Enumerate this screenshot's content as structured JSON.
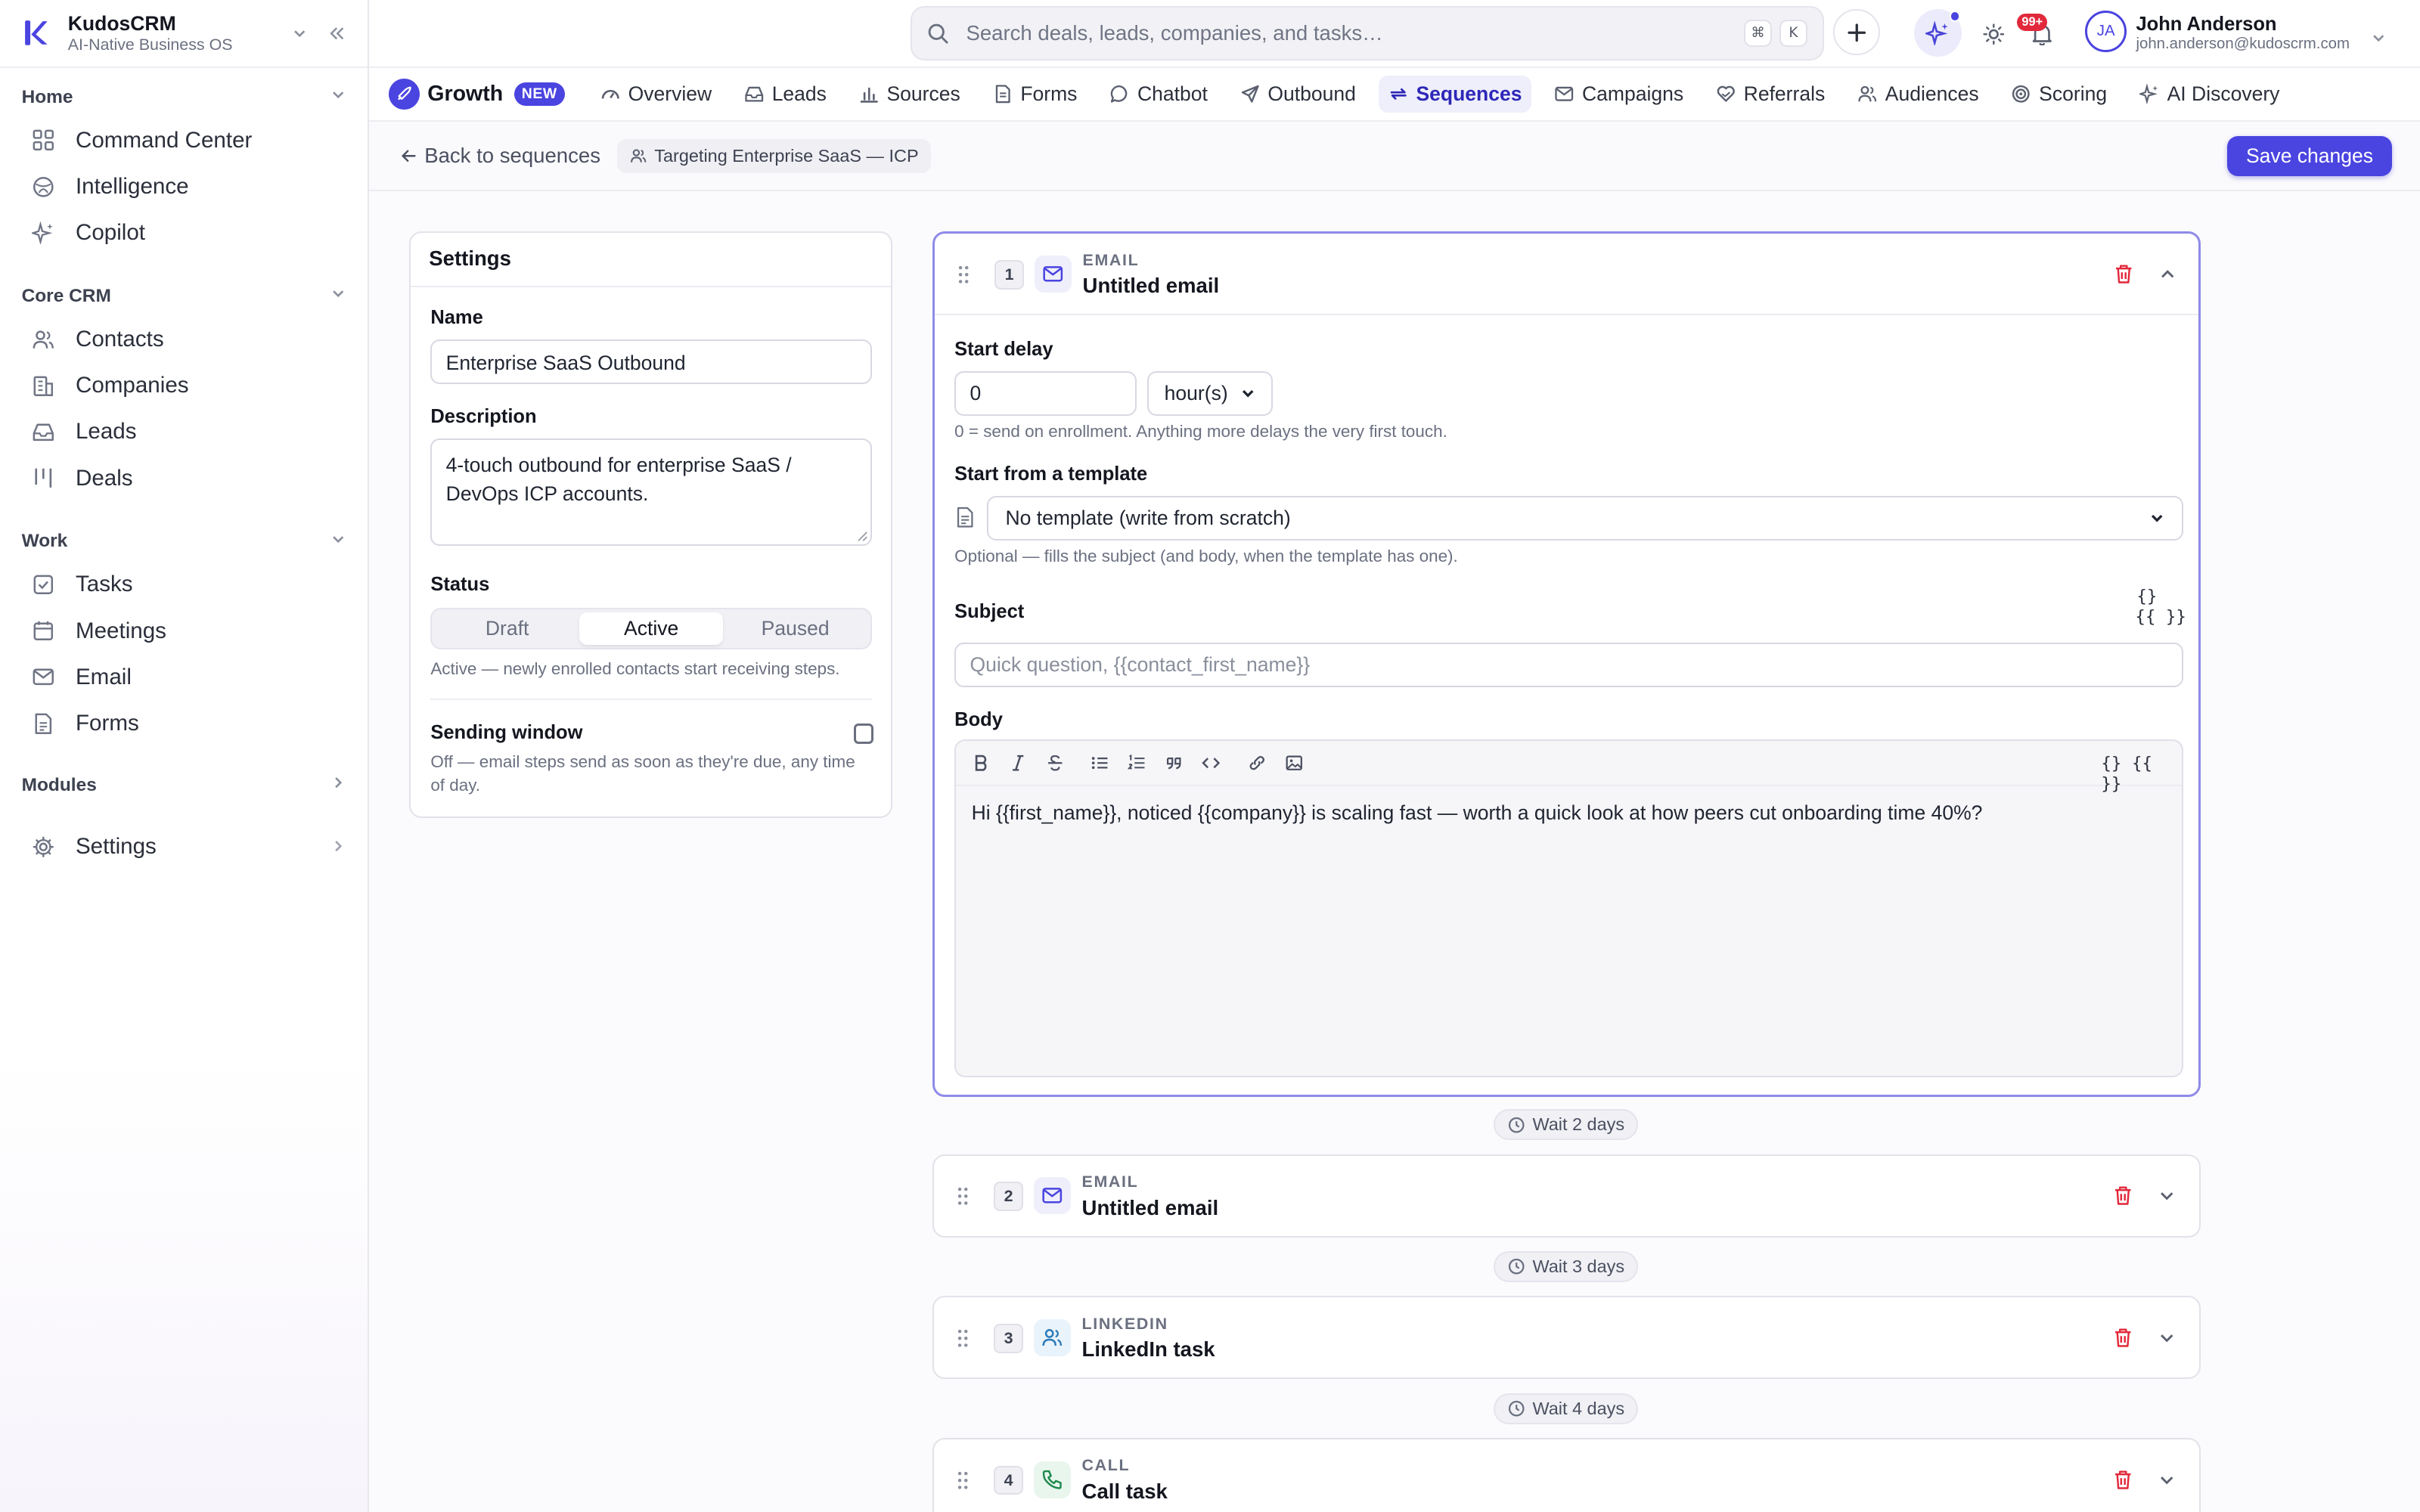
{
  "brand": {
    "name": "KudosCRM",
    "tagline": "AI-Native Business OS"
  },
  "sidebar": {
    "sections": [
      {
        "label": "Home",
        "items": [
          {
            "label": "Command Center",
            "icon": "grid-icon"
          },
          {
            "label": "Intelligence",
            "icon": "globe-icon"
          },
          {
            "label": "Copilot",
            "icon": "sparkle-icon"
          }
        ]
      },
      {
        "label": "Core CRM",
        "items": [
          {
            "label": "Contacts",
            "icon": "users-icon"
          },
          {
            "label": "Companies",
            "icon": "building-icon"
          },
          {
            "label": "Leads",
            "icon": "inbox-icon"
          },
          {
            "label": "Deals",
            "icon": "columns-icon"
          }
        ]
      },
      {
        "label": "Work",
        "items": [
          {
            "label": "Tasks",
            "icon": "checkbox-icon"
          },
          {
            "label": "Meetings",
            "icon": "calendar-icon"
          },
          {
            "label": "Email",
            "icon": "mail-icon"
          },
          {
            "label": "Forms",
            "icon": "document-icon"
          }
        ]
      }
    ],
    "modules_label": "Modules",
    "settings_label": "Settings"
  },
  "topbar": {
    "search_placeholder": "Search deals, leads, companies, and tasks…",
    "shortcut_keys": [
      "⌘",
      "K"
    ],
    "notification_count": "99+",
    "user": {
      "initials": "JA",
      "name": "John Anderson",
      "email": "john.anderson@kudoscrm.com"
    }
  },
  "module": {
    "name": "Growth",
    "badge": "NEW",
    "tabs": [
      {
        "label": "Overview",
        "icon": "gauge-icon",
        "active": false
      },
      {
        "label": "Leads",
        "icon": "inbox-icon",
        "active": false
      },
      {
        "label": "Sources",
        "icon": "bar-chart-icon",
        "active": false
      },
      {
        "label": "Forms",
        "icon": "document-icon",
        "active": false
      },
      {
        "label": "Chatbot",
        "icon": "chat-icon",
        "active": false
      },
      {
        "label": "Outbound",
        "icon": "send-icon",
        "active": false
      },
      {
        "label": "Sequences",
        "icon": "repeat-icon",
        "active": true
      },
      {
        "label": "Campaigns",
        "icon": "mail-icon",
        "active": false
      },
      {
        "label": "Referrals",
        "icon": "heart-hand-icon",
        "active": false
      },
      {
        "label": "Audiences",
        "icon": "users-icon",
        "active": false
      },
      {
        "label": "Scoring",
        "icon": "target-icon",
        "active": false
      },
      {
        "label": "AI Discovery",
        "icon": "sparkle-icon",
        "active": false
      }
    ]
  },
  "subheader": {
    "back_label": "Back to sequences",
    "targeting_label": "Targeting Enterprise SaaS — ICP",
    "save_label": "Save changes"
  },
  "settings": {
    "title": "Settings",
    "name_label": "Name",
    "name_value": "Enterprise SaaS Outbound",
    "description_label": "Description",
    "description_value": "4-touch outbound for enterprise SaaS / DevOps ICP accounts.",
    "status_label": "Status",
    "status_options": [
      "Draft",
      "Active",
      "Paused"
    ],
    "status_selected": "Active",
    "status_hint": "Active — newly enrolled contacts start receiving steps.",
    "sending_window_label": "Sending window",
    "sending_window_enabled": false,
    "sending_window_hint": "Off — email steps send as soon as they're due, any time of day."
  },
  "steps": [
    {
      "number": "1",
      "kind": "EMAIL",
      "title": "Untitled email",
      "expanded": true,
      "start_delay_label": "Start delay",
      "start_delay_value": "0",
      "start_delay_unit": "hour(s)",
      "start_delay_hint": "0 = send on enrollment. Anything more delays the very first touch.",
      "template_label": "Start from a template",
      "template_value": "No template (write from scratch)",
      "template_hint": "Optional — fills the subject (and body, when the template has one).",
      "subject_label": "Subject",
      "subject_placeholder": "Quick question, {{contact_first_name}}",
      "variables_button_icon": "{}",
      "variables_button_label": "{{ }}",
      "body_label": "Body",
      "body_text": "Hi {{first_name}}, noticed {{company}} is scaling fast — worth a quick look at how peers cut onboarding time 40%?"
    },
    {
      "number": "2",
      "kind": "EMAIL",
      "title": "Untitled email",
      "expanded": false
    },
    {
      "number": "3",
      "kind": "LINKEDIN",
      "title": "LinkedIn task",
      "expanded": false
    },
    {
      "number": "4",
      "kind": "CALL",
      "title": "Call task",
      "expanded": false
    }
  ],
  "waits": [
    "Wait 2 days",
    "Wait 3 days",
    "Wait 4 days"
  ],
  "colors": {
    "accent": "#4a44e0",
    "danger": "#e2293b",
    "active_tab_bg": "#efeffb"
  }
}
